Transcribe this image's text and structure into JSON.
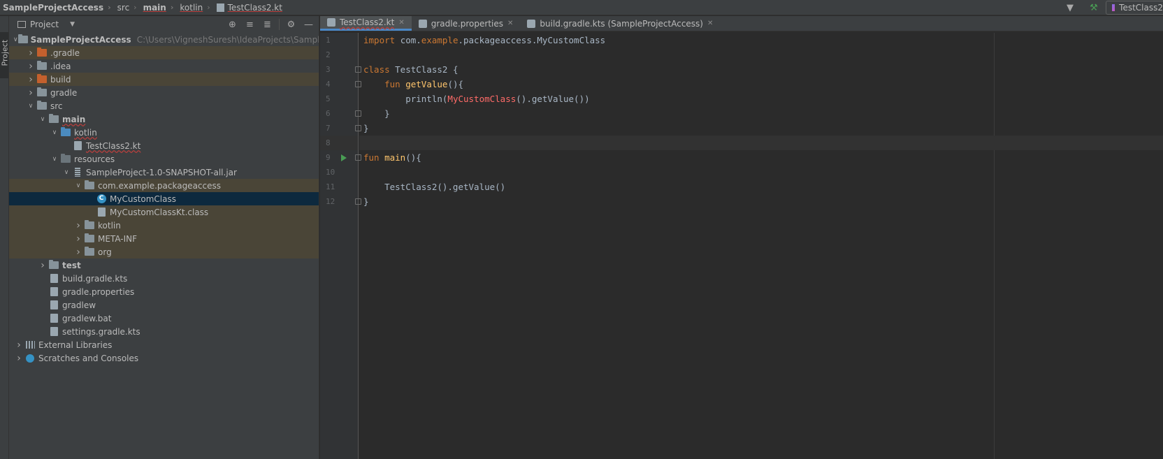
{
  "breadcrumb": [
    {
      "label": "SampleProjectAccess",
      "bold": true
    },
    {
      "label": "src"
    },
    {
      "label": "main",
      "bold": true
    },
    {
      "label": "kotlin"
    },
    {
      "label": "TestClass2.kt"
    }
  ],
  "run_config": {
    "label": "TestClass2"
  },
  "stripe": {
    "label": "Project"
  },
  "panel": {
    "title": "Project"
  },
  "tree": [
    {
      "label": "SampleProjectAccess",
      "path": "C:\\Users\\VigneshSuresh\\IdeaProjects\\SampleProjectAccess",
      "depth": 0,
      "arrow": "open",
      "icon": "module",
      "bold": true
    },
    {
      "label": ".gradle",
      "depth": 1,
      "arrow": "closed",
      "icon": "folder-orange",
      "hl": true
    },
    {
      "label": ".idea",
      "depth": 1,
      "arrow": "closed",
      "icon": "folder"
    },
    {
      "label": "build",
      "depth": 1,
      "arrow": "closed",
      "icon": "folder-orange",
      "hl": true
    },
    {
      "label": "gradle",
      "depth": 1,
      "arrow": "closed",
      "icon": "folder"
    },
    {
      "label": "src",
      "depth": 1,
      "arrow": "open",
      "icon": "folder"
    },
    {
      "label": "main",
      "depth": 2,
      "arrow": "open",
      "icon": "folder",
      "bold": true,
      "err": true
    },
    {
      "label": "kotlin",
      "depth": 3,
      "arrow": "open",
      "icon": "folder-blue",
      "err": true
    },
    {
      "label": "TestClass2.kt",
      "depth": 4,
      "arrow": "none",
      "icon": "file",
      "err": true
    },
    {
      "label": "resources",
      "depth": 3,
      "arrow": "open",
      "icon": "folder-dark"
    },
    {
      "label": "SampleProject-1.0-SNAPSHOT-all.jar",
      "depth": 4,
      "arrow": "open",
      "icon": "jar"
    },
    {
      "label": "com.example.packageaccess",
      "depth": 5,
      "arrow": "open",
      "icon": "folder",
      "hl": true
    },
    {
      "label": "MyCustomClass",
      "depth": 6,
      "arrow": "none",
      "icon": "class",
      "sel": true
    },
    {
      "label": "MyCustomClassKt.class",
      "depth": 6,
      "arrow": "none",
      "icon": "file",
      "hl": true
    },
    {
      "label": "kotlin",
      "depth": 5,
      "arrow": "closed",
      "icon": "folder",
      "hl": true
    },
    {
      "label": "META-INF",
      "depth": 5,
      "arrow": "closed",
      "icon": "folder",
      "hl": true
    },
    {
      "label": "org",
      "depth": 5,
      "arrow": "closed",
      "icon": "folder",
      "hl": true
    },
    {
      "label": "test",
      "depth": 2,
      "arrow": "closed",
      "icon": "folder",
      "bold": true
    },
    {
      "label": "build.gradle.kts",
      "depth": 2,
      "arrow": "none",
      "icon": "file"
    },
    {
      "label": "gradle.properties",
      "depth": 2,
      "arrow": "none",
      "icon": "file"
    },
    {
      "label": "gradlew",
      "depth": 2,
      "arrow": "none",
      "icon": "file"
    },
    {
      "label": "gradlew.bat",
      "depth": 2,
      "arrow": "none",
      "icon": "file"
    },
    {
      "label": "settings.gradle.kts",
      "depth": 2,
      "arrow": "none",
      "icon": "file"
    },
    {
      "label": "External Libraries",
      "depth": 0,
      "arrow": "closed",
      "icon": "library"
    },
    {
      "label": "Scratches and Consoles",
      "depth": 0,
      "arrow": "closed",
      "icon": "scratch"
    }
  ],
  "tabs": [
    {
      "label": "TestClass2.kt",
      "active": true,
      "err": true
    },
    {
      "label": "gradle.properties"
    },
    {
      "label": "build.gradle.kts (SampleProjectAccess)"
    }
  ],
  "code": [
    {
      "n": "1",
      "tokens": [
        [
          "kw",
          "import "
        ],
        [
          "pl",
          "com."
        ],
        [
          "pkg",
          "example"
        ],
        [
          "pl",
          ".packageaccess.MyCustomClass"
        ]
      ]
    },
    {
      "n": "2",
      "tokens": []
    },
    {
      "n": "3",
      "fold": true,
      "tokens": [
        [
          "kw",
          "class "
        ],
        [
          "pl",
          "TestClass2 {"
        ]
      ]
    },
    {
      "n": "4",
      "fold": true,
      "tokens": [
        [
          "pl",
          "    "
        ],
        [
          "kw",
          "fun "
        ],
        [
          "fn",
          "getValue"
        ],
        [
          "pl",
          "(){"
        ]
      ]
    },
    {
      "n": "5",
      "tokens": [
        [
          "pl",
          "        println("
        ],
        [
          "red",
          "MyCustomClass"
        ],
        [
          "pl",
          "().getValue())"
        ]
      ]
    },
    {
      "n": "6",
      "fold": true,
      "tokens": [
        [
          "pl",
          "    }"
        ]
      ]
    },
    {
      "n": "7",
      "fold": true,
      "tokens": [
        [
          "pl",
          "}"
        ]
      ]
    },
    {
      "n": "8",
      "current": true,
      "tokens": []
    },
    {
      "n": "9",
      "fold": true,
      "run": true,
      "tokens": [
        [
          "kw",
          "fun "
        ],
        [
          "fn",
          "main"
        ],
        [
          "pl",
          "(){"
        ]
      ]
    },
    {
      "n": "10",
      "tokens": []
    },
    {
      "n": "11",
      "tokens": [
        [
          "pl",
          "    TestClass2().getValue()"
        ]
      ]
    },
    {
      "n": "12",
      "fold": true,
      "tokens": [
        [
          "pl",
          "}"
        ]
      ]
    }
  ]
}
